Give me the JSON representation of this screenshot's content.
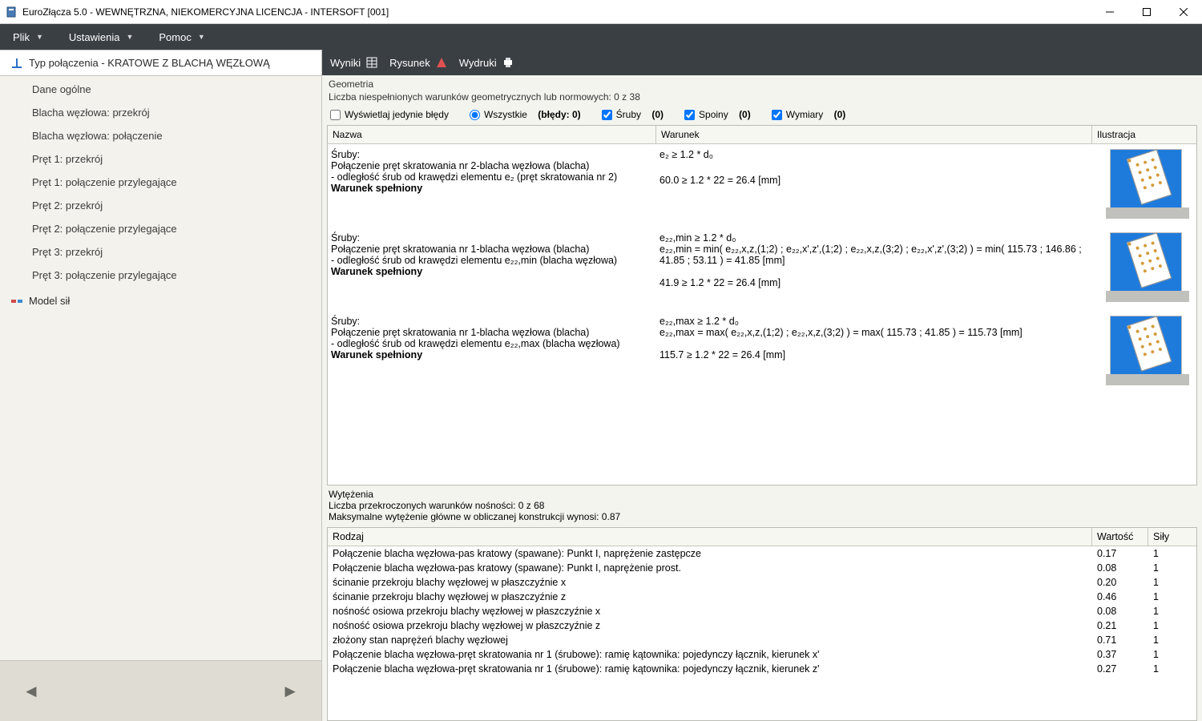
{
  "window": {
    "title": "EuroZłącza 5.0 - WEWNĘTRZNA, NIEKOMERCYJNA LICENCJA - INTERSOFT [001]"
  },
  "menu": {
    "items": [
      "Plik",
      "Ustawienia",
      "Pomoc"
    ]
  },
  "sidebar": {
    "header": "Typ połączenia - KRATOWE Z BLACHĄ WĘZŁOWĄ",
    "items": [
      "Dane ogólne",
      "Blacha węzłowa: przekrój",
      "Blacha węzłowa: połączenie",
      "Pręt 1: przekrój",
      "Pręt 1: połączenie przylegające",
      "Pręt 2: przekrój",
      "Pręt 2: połączenie przylegające",
      "Pręt 3: przekrój",
      "Pręt 3: połączenie przylegające"
    ],
    "model": "Model sił"
  },
  "right_toolbar": {
    "wyniki": "Wyniki",
    "rysunek": "Rysunek",
    "wydruki": "Wydruki"
  },
  "geometry": {
    "title": "Geometria",
    "sub": "Liczba niespełnionych warunków geometrycznych lub normowych: 0 z 38",
    "filters": {
      "errors_only": "Wyświetlaj jedynie błędy",
      "all": "Wszystkie",
      "all_count": "(błędy: 0)",
      "sruby": "Śruby",
      "sruby_count": "(0)",
      "spoiny": "Spoiny",
      "spoiny_count": "(0)",
      "wymiary": "Wymiary",
      "wymiary_count": "(0)"
    },
    "columns": {
      "name": "Nazwa",
      "cond": "Warunek",
      "illu": "Ilustracja"
    },
    "rows": [
      {
        "name_l1": "Śruby:",
        "name_l2": "Połączenie pręt skratowania nr 2-blacha węzłowa (blacha)",
        "name_l3": "- odległość śrub od krawędzi elementu e₂ (pręt skratowania nr 2)",
        "satisfied": "Warunek spełniony",
        "cond_l1": "e₂ ≥ 1.2 * d₀",
        "cond_l2": "60.0 ≥ 1.2 * 22 = 26.4 [mm]"
      },
      {
        "name_l1": "Śruby:",
        "name_l2": "Połączenie pręt skratowania nr 1-blacha węzłowa (blacha)",
        "name_l3": "- odległość śrub od krawędzi elementu e₂₂,min (blacha węzłowa)",
        "satisfied": "Warunek spełniony",
        "cond_l1": "e₂₂,min ≥ 1.2 * d₀",
        "cond_l2": "e₂₂,min = min( e₂₂,x,z,(1;2) ; e₂₂,x',z',(1;2) ; e₂₂,x,z,(3;2) ; e₂₂,x',z',(3;2) ) = min( 115.73 ; 146.86 ; 41.85 ; 53.11 ) = 41.85 [mm]",
        "cond_l3": "41.9 ≥ 1.2 * 22 = 26.4 [mm]"
      },
      {
        "name_l1": "Śruby:",
        "name_l2": "Połączenie pręt skratowania nr 1-blacha węzłowa (blacha)",
        "name_l3": "- odległość śrub od krawędzi elementu e₂₂,max (blacha węzłowa)",
        "satisfied": "Warunek spełniony",
        "cond_l1": "e₂₂,max ≥ 1.2 * d₀",
        "cond_l2": "e₂₂,max = max( e₂₂,x,z,(1;2) ; e₂₂,x,z,(3;2) ) = max( 115.73 ; 41.85 ) = 115.73 [mm]",
        "cond_l3": "115.7 ≥ 1.2 * 22 = 26.4 [mm]"
      }
    ]
  },
  "wytezenia": {
    "title": "Wytężenia",
    "line1": "Liczba przekroczonych warunków nośności: 0 z 68",
    "line2": "Maksymalne wytężenie główne w obliczanej konstrukcji wynosi: 0.87",
    "columns": {
      "rodzaj": "Rodzaj",
      "wartosc": "Wartość",
      "sily": "Siły"
    },
    "rows": [
      {
        "r": "Połączenie blacha węzłowa-pas kratowy (spawane): Punkt I, naprężenie zastępcze",
        "w": "0.17",
        "s": "1"
      },
      {
        "r": "Połączenie blacha węzłowa-pas kratowy (spawane): Punkt I, naprężenie prost.",
        "w": "0.08",
        "s": "1"
      },
      {
        "r": "ścinanie przekroju blachy węzłowej w płaszczyźnie x",
        "w": "0.20",
        "s": "1"
      },
      {
        "r": "ścinanie przekroju blachy węzłowej w płaszczyźnie z",
        "w": "0.46",
        "s": "1"
      },
      {
        "r": "nośność osiowa przekroju blachy węzłowej w płaszczyźnie x",
        "w": "0.08",
        "s": "1"
      },
      {
        "r": "nośność osiowa przekroju blachy węzłowej w płaszczyźnie z",
        "w": "0.21",
        "s": "1"
      },
      {
        "r": "złożony stan naprężeń blachy węzłowej",
        "w": "0.71",
        "s": "1"
      },
      {
        "r": "Połączenie blacha węzłowa-pręt skratowania nr 1 (śrubowe): ramię kątownika: pojedynczy łącznik, kierunek x'",
        "w": "0.37",
        "s": "1"
      },
      {
        "r": "Połączenie blacha węzłowa-pręt skratowania nr 1 (śrubowe): ramię kątownika: pojedynczy łącznik, kierunek z'",
        "w": "0.27",
        "s": "1"
      }
    ]
  }
}
